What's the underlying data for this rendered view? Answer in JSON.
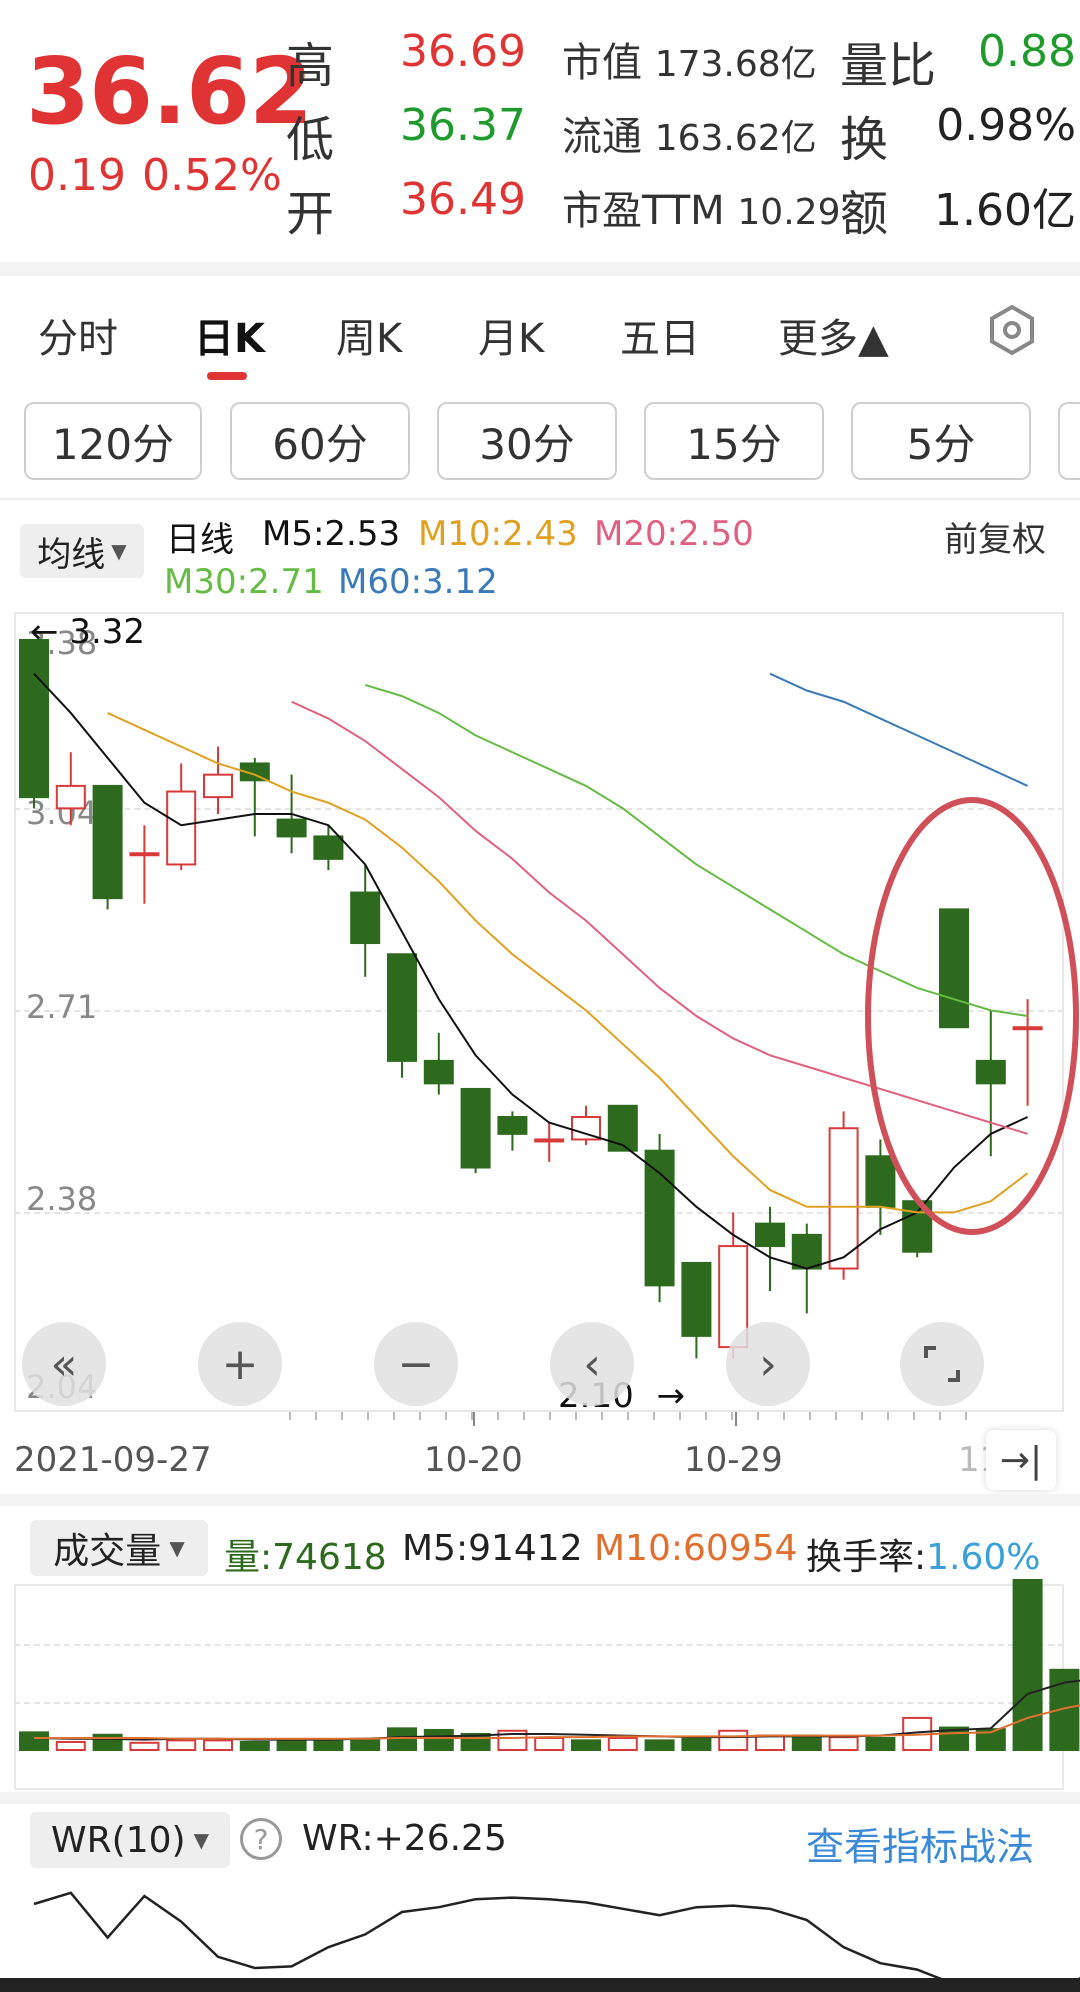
{
  "quote": {
    "price": "36.62",
    "change": "0.19",
    "change_pct": "0.52%",
    "high_label": "高",
    "high": "36.69",
    "low_label": "低",
    "low": "36.37",
    "open_label": "开",
    "open": "36.49",
    "mcap_label": "市值",
    "mcap": "173.68亿",
    "float_label": "流通",
    "float": "163.62亿",
    "pe_label": "市盈TTM",
    "pe": "10.29",
    "vr_label": "量比",
    "vr": "0.88",
    "turnover_label": "换",
    "turnover": "0.98%",
    "amount_label": "额",
    "amount": "1.60亿",
    "up_color": "#e03434",
    "down_color": "#1f9a2c"
  },
  "tabs": [
    {
      "label": "分时"
    },
    {
      "label": "日K"
    },
    {
      "label": "周K"
    },
    {
      "label": "月K"
    },
    {
      "label": "五日"
    },
    {
      "label": "更多▲"
    }
  ],
  "periods": [
    {
      "label": "120分"
    },
    {
      "label": "60分"
    },
    {
      "label": "30分"
    },
    {
      "label": "15分"
    },
    {
      "label": "5分"
    }
  ],
  "kline": {
    "indicator_select": "均线",
    "line_label": "日线",
    "adjust_label": "前复权",
    "ma": [
      {
        "label": "M5:2.53",
        "color": "#111111"
      },
      {
        "label": "M10:2.43",
        "color": "#e0a020"
      },
      {
        "label": "M20:2.50",
        "color": "#e06080"
      },
      {
        "label": "M30:2.71",
        "color": "#66bb44"
      },
      {
        "label": "M60:3.12",
        "color": "#3a7ab8"
      }
    ],
    "y_ticks": [
      "3.38",
      "3.04",
      "2.71",
      "2.38",
      "2.04"
    ],
    "max_marker": "3.32",
    "min_marker": "2.10",
    "dates": [
      "2021-09-27",
      "10-20",
      "10-29",
      "11"
    ],
    "up_color": "#d83a3a",
    "down_color": "#2d6a1e",
    "highlight_color": "#d0505a"
  },
  "chart_data": {
    "type": "candlestick",
    "dates_shown": [
      "2021-09-27",
      "10-20",
      "10-29",
      "11"
    ],
    "ylim": [
      2.04,
      3.38
    ],
    "candles": [
      {
        "o": 3.38,
        "h": 3.38,
        "l": 3.08,
        "c": 3.1
      },
      {
        "o": 3.08,
        "h": 3.18,
        "l": 3.05,
        "c": 3.12
      },
      {
        "o": 3.12,
        "h": 3.12,
        "l": 2.9,
        "c": 2.92
      },
      {
        "o": 3.0,
        "h": 3.05,
        "l": 2.91,
        "c": 3.0
      },
      {
        "o": 2.98,
        "h": 3.16,
        "l": 2.97,
        "c": 3.11
      },
      {
        "o": 3.1,
        "h": 3.19,
        "l": 3.07,
        "c": 3.14
      },
      {
        "o": 3.16,
        "h": 3.17,
        "l": 3.03,
        "c": 3.13
      },
      {
        "o": 3.06,
        "h": 3.14,
        "l": 3.0,
        "c": 3.03
      },
      {
        "o": 3.03,
        "h": 3.05,
        "l": 2.97,
        "c": 2.99
      },
      {
        "o": 2.93,
        "h": 2.98,
        "l": 2.78,
        "c": 2.84
      },
      {
        "o": 2.82,
        "h": 2.82,
        "l": 2.6,
        "c": 2.63
      },
      {
        "o": 2.63,
        "h": 2.68,
        "l": 2.57,
        "c": 2.59
      },
      {
        "o": 2.58,
        "h": 2.58,
        "l": 2.43,
        "c": 2.44
      },
      {
        "o": 2.53,
        "h": 2.54,
        "l": 2.47,
        "c": 2.5
      },
      {
        "o": 2.49,
        "h": 2.52,
        "l": 2.45,
        "c": 2.49
      },
      {
        "o": 2.49,
        "h": 2.55,
        "l": 2.48,
        "c": 2.53
      },
      {
        "o": 2.55,
        "h": 2.55,
        "l": 2.47,
        "c": 2.47
      },
      {
        "o": 2.47,
        "h": 2.5,
        "l": 2.2,
        "c": 2.23
      },
      {
        "o": 2.27,
        "h": 2.27,
        "l": 2.1,
        "c": 2.14
      },
      {
        "o": 2.12,
        "h": 2.36,
        "l": 2.1,
        "c": 2.3
      },
      {
        "o": 2.34,
        "h": 2.37,
        "l": 2.22,
        "c": 2.3
      },
      {
        "o": 2.32,
        "h": 2.34,
        "l": 2.18,
        "c": 2.26
      },
      {
        "o": 2.26,
        "h": 2.54,
        "l": 2.24,
        "c": 2.51
      },
      {
        "o": 2.46,
        "h": 2.49,
        "l": 2.32,
        "c": 2.37
      },
      {
        "o": 2.38,
        "h": 2.38,
        "l": 2.28,
        "c": 2.29
      },
      {
        "o": 2.9,
        "h": 2.9,
        "l": 2.69,
        "c": 2.69
      },
      {
        "o": 2.63,
        "h": 2.72,
        "l": 2.46,
        "c": 2.59
      },
      {
        "o": 2.69,
        "h": 2.74,
        "l": 2.55,
        "c": 2.69
      }
    ],
    "ma5": [
      3.32,
      3.25,
      3.17,
      3.09,
      3.05,
      3.06,
      3.07,
      3.07,
      3.05,
      2.98,
      2.86,
      2.74,
      2.64,
      2.57,
      2.52,
      2.5,
      2.48,
      2.43,
      2.37,
      2.32,
      2.28,
      2.26,
      2.28,
      2.33,
      2.36,
      2.44,
      2.5,
      2.53
    ],
    "ma10": [
      null,
      null,
      3.25,
      3.22,
      3.19,
      3.16,
      3.14,
      3.11,
      3.09,
      3.06,
      3.01,
      2.95,
      2.88,
      2.82,
      2.77,
      2.72,
      2.66,
      2.6,
      2.53,
      2.46,
      2.4,
      2.37,
      2.37,
      2.37,
      2.36,
      2.36,
      2.38,
      2.43
    ],
    "ma20": [
      null,
      null,
      null,
      null,
      null,
      null,
      null,
      3.27,
      3.24,
      3.2,
      3.15,
      3.1,
      3.04,
      2.99,
      2.93,
      2.88,
      2.82,
      2.76,
      2.71,
      2.67,
      2.64,
      2.62,
      2.6,
      2.58,
      2.56,
      2.54,
      2.52,
      2.5
    ],
    "ma30": [
      null,
      null,
      null,
      null,
      null,
      null,
      null,
      null,
      null,
      3.3,
      3.28,
      3.25,
      3.21,
      3.18,
      3.15,
      3.12,
      3.08,
      3.03,
      2.98,
      2.94,
      2.9,
      2.86,
      2.82,
      2.79,
      2.76,
      2.74,
      2.72,
      2.71
    ],
    "ma60": [
      null,
      null,
      null,
      null,
      null,
      null,
      null,
      null,
      null,
      null,
      null,
      null,
      null,
      null,
      null,
      null,
      null,
      null,
      null,
      null,
      3.32,
      3.29,
      3.27,
      3.24,
      3.21,
      3.18,
      3.15,
      3.12
    ]
  },
  "volume": {
    "indicator_select": "成交量",
    "vol_label": "量:74618",
    "m5_label": "M5:91412",
    "m10_label": "M10:60954",
    "turnover_label": "换手率:",
    "turnover_value": "1.60%",
    "bars": [
      22,
      10,
      19,
      9,
      12,
      12,
      10,
      12,
      12,
      14,
      27,
      25,
      20,
      24,
      15,
      12,
      15,
      12,
      16,
      24,
      18,
      18,
      16,
      15,
      40,
      28,
      26,
      212,
      100,
      80
    ],
    "ma5": [
      15,
      14,
      14,
      13,
      14,
      14,
      13,
      13,
      13,
      14,
      16,
      17,
      18,
      20,
      20,
      19,
      18,
      17,
      16,
      16,
      17,
      17,
      17,
      18,
      22,
      25,
      27,
      70,
      84,
      90
    ],
    "ma10": [
      15,
      15,
      15,
      15,
      14,
      14,
      14,
      14,
      14,
      14,
      15,
      15,
      15,
      15,
      16,
      16,
      17,
      17,
      17,
      17,
      18,
      18,
      18,
      18,
      19,
      21,
      22,
      40,
      52,
      61
    ]
  },
  "wr": {
    "indicator_select": "WR(10)",
    "help": "?",
    "value_label": "WR:+26.25",
    "strategy_link": "查看指标战法",
    "series": [
      45,
      38,
      66,
      40,
      56,
      78,
      85,
      84,
      72,
      64,
      50,
      47,
      42,
      41,
      42,
      44,
      48,
      52,
      47,
      46,
      48,
      55,
      72,
      82,
      86,
      95,
      100,
      100,
      100,
      80
    ]
  }
}
